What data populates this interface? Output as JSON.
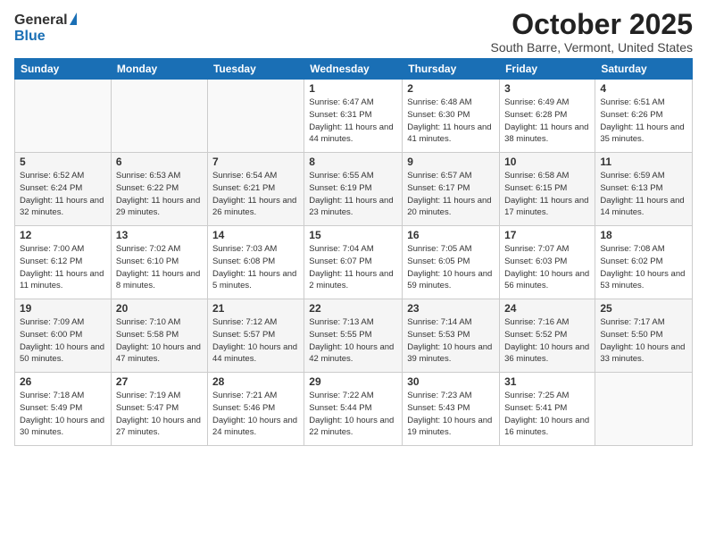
{
  "logo": {
    "general": "General",
    "blue": "Blue"
  },
  "title": "October 2025",
  "location": "South Barre, Vermont, United States",
  "weekdays": [
    "Sunday",
    "Monday",
    "Tuesday",
    "Wednesday",
    "Thursday",
    "Friday",
    "Saturday"
  ],
  "weeks": [
    [
      {
        "day": "",
        "info": ""
      },
      {
        "day": "",
        "info": ""
      },
      {
        "day": "",
        "info": ""
      },
      {
        "day": "1",
        "info": "Sunrise: 6:47 AM\nSunset: 6:31 PM\nDaylight: 11 hours\nand 44 minutes."
      },
      {
        "day": "2",
        "info": "Sunrise: 6:48 AM\nSunset: 6:30 PM\nDaylight: 11 hours\nand 41 minutes."
      },
      {
        "day": "3",
        "info": "Sunrise: 6:49 AM\nSunset: 6:28 PM\nDaylight: 11 hours\nand 38 minutes."
      },
      {
        "day": "4",
        "info": "Sunrise: 6:51 AM\nSunset: 6:26 PM\nDaylight: 11 hours\nand 35 minutes."
      }
    ],
    [
      {
        "day": "5",
        "info": "Sunrise: 6:52 AM\nSunset: 6:24 PM\nDaylight: 11 hours\nand 32 minutes."
      },
      {
        "day": "6",
        "info": "Sunrise: 6:53 AM\nSunset: 6:22 PM\nDaylight: 11 hours\nand 29 minutes."
      },
      {
        "day": "7",
        "info": "Sunrise: 6:54 AM\nSunset: 6:21 PM\nDaylight: 11 hours\nand 26 minutes."
      },
      {
        "day": "8",
        "info": "Sunrise: 6:55 AM\nSunset: 6:19 PM\nDaylight: 11 hours\nand 23 minutes."
      },
      {
        "day": "9",
        "info": "Sunrise: 6:57 AM\nSunset: 6:17 PM\nDaylight: 11 hours\nand 20 minutes."
      },
      {
        "day": "10",
        "info": "Sunrise: 6:58 AM\nSunset: 6:15 PM\nDaylight: 11 hours\nand 17 minutes."
      },
      {
        "day": "11",
        "info": "Sunrise: 6:59 AM\nSunset: 6:13 PM\nDaylight: 11 hours\nand 14 minutes."
      }
    ],
    [
      {
        "day": "12",
        "info": "Sunrise: 7:00 AM\nSunset: 6:12 PM\nDaylight: 11 hours\nand 11 minutes."
      },
      {
        "day": "13",
        "info": "Sunrise: 7:02 AM\nSunset: 6:10 PM\nDaylight: 11 hours\nand 8 minutes."
      },
      {
        "day": "14",
        "info": "Sunrise: 7:03 AM\nSunset: 6:08 PM\nDaylight: 11 hours\nand 5 minutes."
      },
      {
        "day": "15",
        "info": "Sunrise: 7:04 AM\nSunset: 6:07 PM\nDaylight: 11 hours\nand 2 minutes."
      },
      {
        "day": "16",
        "info": "Sunrise: 7:05 AM\nSunset: 6:05 PM\nDaylight: 10 hours\nand 59 minutes."
      },
      {
        "day": "17",
        "info": "Sunrise: 7:07 AM\nSunset: 6:03 PM\nDaylight: 10 hours\nand 56 minutes."
      },
      {
        "day": "18",
        "info": "Sunrise: 7:08 AM\nSunset: 6:02 PM\nDaylight: 10 hours\nand 53 minutes."
      }
    ],
    [
      {
        "day": "19",
        "info": "Sunrise: 7:09 AM\nSunset: 6:00 PM\nDaylight: 10 hours\nand 50 minutes."
      },
      {
        "day": "20",
        "info": "Sunrise: 7:10 AM\nSunset: 5:58 PM\nDaylight: 10 hours\nand 47 minutes."
      },
      {
        "day": "21",
        "info": "Sunrise: 7:12 AM\nSunset: 5:57 PM\nDaylight: 10 hours\nand 44 minutes."
      },
      {
        "day": "22",
        "info": "Sunrise: 7:13 AM\nSunset: 5:55 PM\nDaylight: 10 hours\nand 42 minutes."
      },
      {
        "day": "23",
        "info": "Sunrise: 7:14 AM\nSunset: 5:53 PM\nDaylight: 10 hours\nand 39 minutes."
      },
      {
        "day": "24",
        "info": "Sunrise: 7:16 AM\nSunset: 5:52 PM\nDaylight: 10 hours\nand 36 minutes."
      },
      {
        "day": "25",
        "info": "Sunrise: 7:17 AM\nSunset: 5:50 PM\nDaylight: 10 hours\nand 33 minutes."
      }
    ],
    [
      {
        "day": "26",
        "info": "Sunrise: 7:18 AM\nSunset: 5:49 PM\nDaylight: 10 hours\nand 30 minutes."
      },
      {
        "day": "27",
        "info": "Sunrise: 7:19 AM\nSunset: 5:47 PM\nDaylight: 10 hours\nand 27 minutes."
      },
      {
        "day": "28",
        "info": "Sunrise: 7:21 AM\nSunset: 5:46 PM\nDaylight: 10 hours\nand 24 minutes."
      },
      {
        "day": "29",
        "info": "Sunrise: 7:22 AM\nSunset: 5:44 PM\nDaylight: 10 hours\nand 22 minutes."
      },
      {
        "day": "30",
        "info": "Sunrise: 7:23 AM\nSunset: 5:43 PM\nDaylight: 10 hours\nand 19 minutes."
      },
      {
        "day": "31",
        "info": "Sunrise: 7:25 AM\nSunset: 5:41 PM\nDaylight: 10 hours\nand 16 minutes."
      },
      {
        "day": "",
        "info": ""
      }
    ]
  ]
}
